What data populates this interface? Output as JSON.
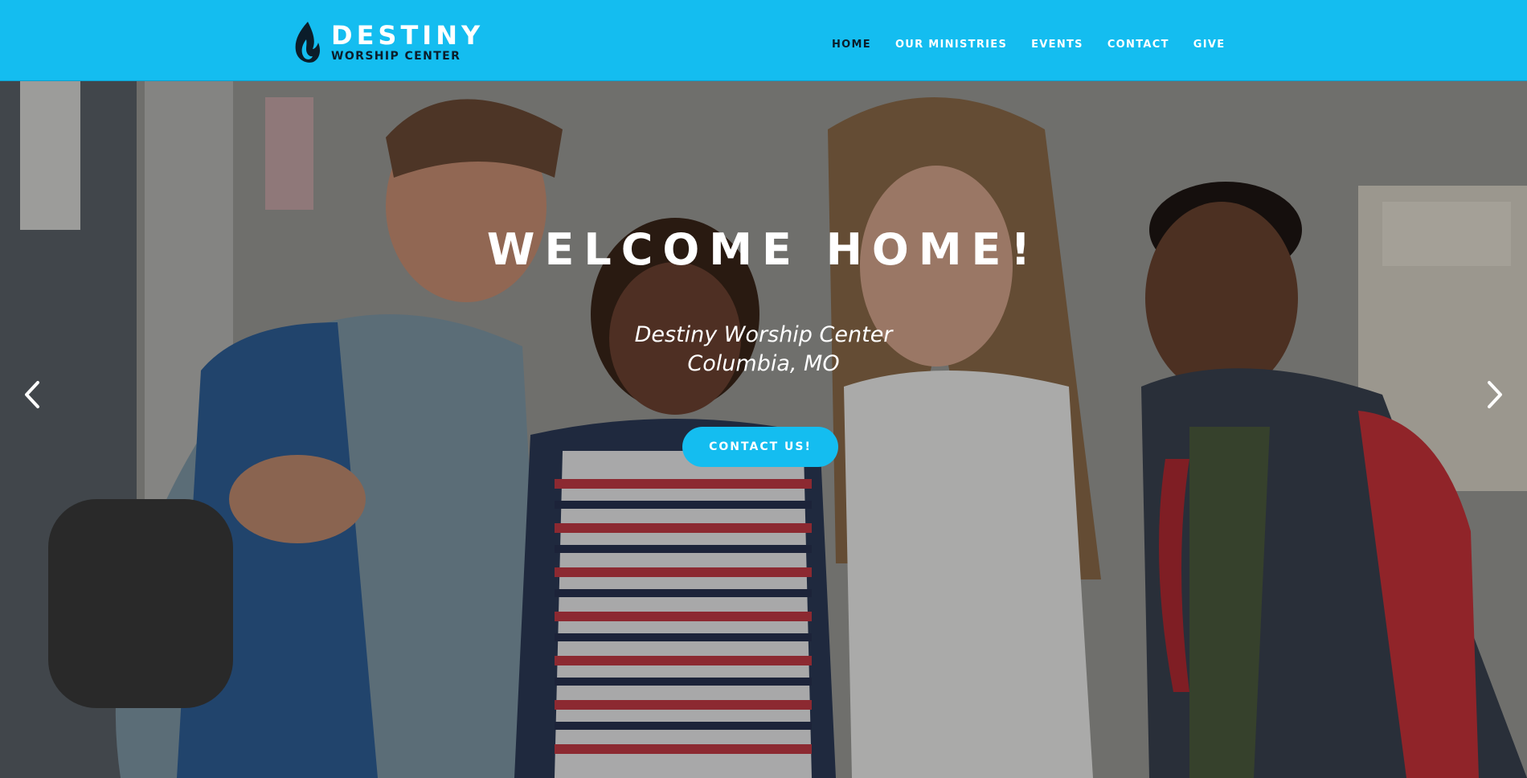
{
  "brand": {
    "title": "DESTINY",
    "subtitle": "WORSHIP CENTER",
    "logo_icon": "flame-icon"
  },
  "nav": {
    "items": [
      {
        "label": "HOME",
        "active": true
      },
      {
        "label": "OUR MINISTRIES",
        "active": false
      },
      {
        "label": "EVENTS",
        "active": false
      },
      {
        "label": "CONTACT",
        "active": false
      },
      {
        "label": "GIVE",
        "active": false
      }
    ]
  },
  "hero": {
    "title": "WELCOME HOME!",
    "subtitle_line1": "Destiny Worship Center",
    "subtitle_line2": "Columbia, MO",
    "cta_label": "CONTACT US!",
    "prev_icon": "chevron-left-icon",
    "next_icon": "chevron-right-icon"
  },
  "colors": {
    "header_bg": "#14bdf0",
    "accent": "#14bdf0",
    "dark_text": "#0b1d2a",
    "light_text": "#ffffff"
  }
}
